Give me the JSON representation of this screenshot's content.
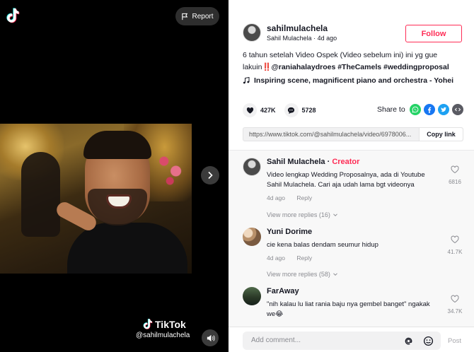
{
  "video": {
    "report_label": "Report",
    "watermark_brand": "TikTok",
    "watermark_user": "@sahilmulachela"
  },
  "author": {
    "handle": "sahilmulachela",
    "display_name": "Sahil Mulachela",
    "age": "4d ago",
    "follow_label": "Follow"
  },
  "description": {
    "line1": "6 tahun setelah Video Ospek (Video sebelum ini) ini yg gue",
    "line2_prefix": "lakuin",
    "bang": "‼️",
    "tags": "@raniahalaydroes #TheCamels #weddingproposal"
  },
  "music": {
    "title": "Inspiring scene, magnificent piano and orchestra - Yohei"
  },
  "stats": {
    "likes": "427K",
    "comments": "5728"
  },
  "share": {
    "label": "Share to"
  },
  "link": {
    "url": "https://www.tiktok.com/@sahilmulachela/video/6978006...",
    "copy_label": "Copy link"
  },
  "comments": [
    {
      "name": "Sahil Mulachela",
      "badge": "Creator",
      "text": "Video lengkap Wedding Proposalnya, ada di Youtube Sahil Mulachela. Cari aja udah lama bgt videonya",
      "age": "4d ago",
      "reply_label": "Reply",
      "likes": "6816",
      "view_more": "View more replies (16)"
    },
    {
      "name": "Yuni Dorime",
      "text": "cie kena balas dendam seumur hidup",
      "age": "4d ago",
      "reply_label": "Reply",
      "likes": "41.7K",
      "view_more": "View more replies (58)"
    },
    {
      "name": "FarAway",
      "text": "\"nih kalau lu liat rania baju nya gembel banget\" ngakak we😂",
      "likes": "34.7K"
    }
  ],
  "footer": {
    "placeholder": "Add comment...",
    "post_label": "Post"
  },
  "colors": {
    "accent": "#fe2c55",
    "whatsapp": "#25d366",
    "facebook": "#1877f2",
    "twitter": "#1da1f2"
  }
}
